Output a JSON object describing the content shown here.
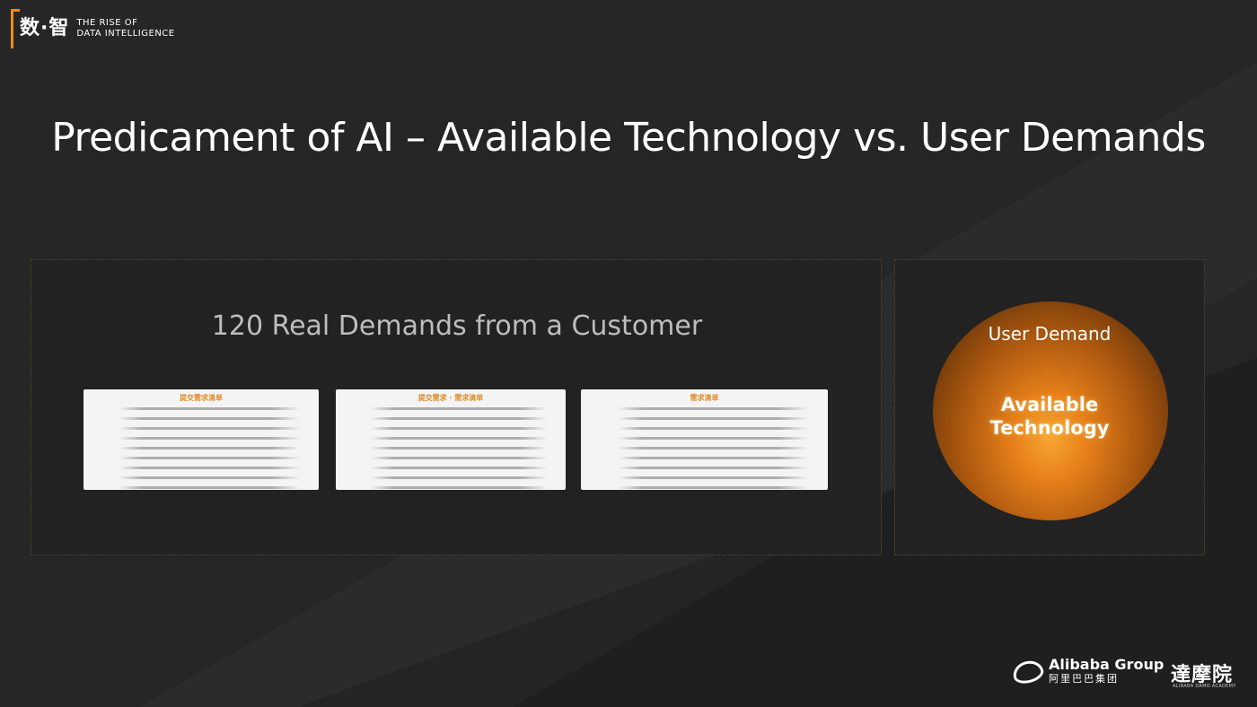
{
  "logo": {
    "cn": "数·智",
    "en_line1": "THE RISE OF",
    "en_line2": "DATA INTELLIGENCE"
  },
  "title": "Predicament of AI – Available Technology vs. User Demands",
  "left_panel": {
    "heading": "120 Real Demands from a Customer",
    "documents": [
      {
        "header": "提交需求清单"
      },
      {
        "header": "提交需求 · 需求清单"
      },
      {
        "header": "需求清单"
      }
    ]
  },
  "right_panel": {
    "outer_label": "User Demand",
    "inner_label_line1": "Available",
    "inner_label_line2": "Technology"
  },
  "footer": {
    "alibaba_en": "Alibaba Group",
    "alibaba_cn": "阿里巴巴集团",
    "damo": "達摩院",
    "damo_sub": "ALIBABA DAMO ACADEMY"
  },
  "colors": {
    "accent": "#f28b1e",
    "background": "#262626",
    "panel": "#222222"
  }
}
